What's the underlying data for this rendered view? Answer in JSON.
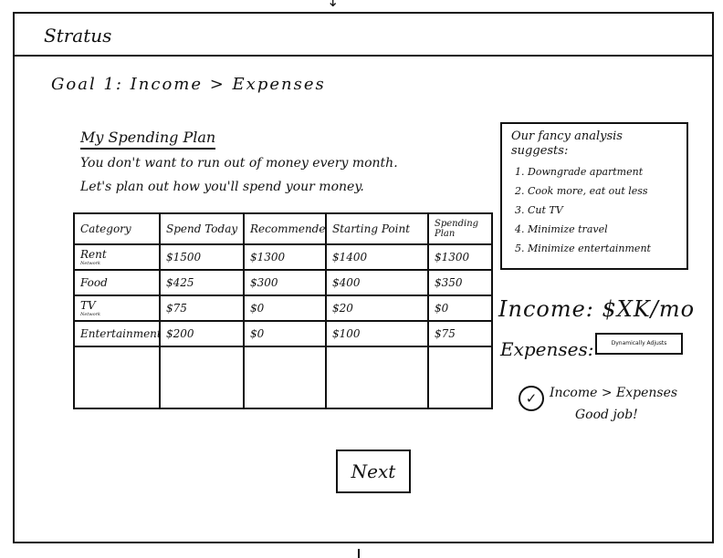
{
  "app": {
    "title": "Stratus"
  },
  "goal": "Goal 1: Income > Expenses",
  "plan": {
    "title": "My Spending Plan",
    "intro_line1": "You don't want to run out of money every month.",
    "intro_line2": "Let's plan out how you'll spend your money."
  },
  "table": {
    "headers": [
      "Category",
      "Spend Today",
      "Recommended",
      "Starting Point",
      "Spending Plan"
    ],
    "rows": [
      {
        "category": "Rent",
        "sub": "Network",
        "spend_today": "$1500",
        "recommended": "$1300",
        "starting_point": "$1400",
        "spending_plan": "$1300"
      },
      {
        "category": "Food",
        "sub": "",
        "spend_today": "$425",
        "recommended": "$300",
        "starting_point": "$400",
        "spending_plan": "$350"
      },
      {
        "category": "TV",
        "sub": "Network",
        "spend_today": "$75",
        "recommended": "$0",
        "starting_point": "$20",
        "spending_plan": "$0"
      },
      {
        "category": "Entertainment",
        "sub": "",
        "spend_today": "$200",
        "recommended": "$0",
        "starting_point": "$100",
        "spending_plan": "$75"
      }
    ]
  },
  "analysis": {
    "title": "Our fancy analysis suggests:",
    "items": [
      "Downgrade apartment",
      "Cook more, eat out less",
      "Cut TV",
      "Minimize travel",
      "Minimize entertainment"
    ]
  },
  "summary": {
    "income": "Income: $XK/mo",
    "expenses_label": "Expenses:",
    "expenses_value": "Dynamically Adjusts",
    "status": "Income > Expenses",
    "status_message": "Good job!",
    "status_icon": "check-icon"
  },
  "next_label": "Next"
}
